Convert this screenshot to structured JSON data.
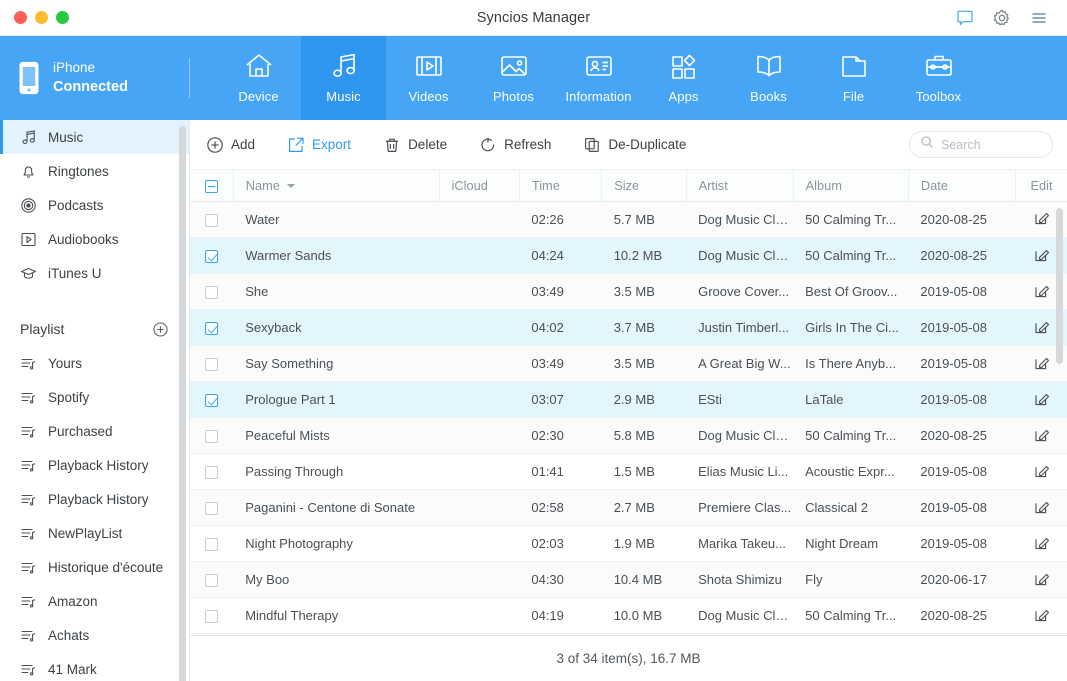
{
  "window": {
    "title": "Syncios Manager",
    "traffic_lights": [
      "close",
      "minimize",
      "maximize"
    ],
    "actions": [
      {
        "name": "feedback-icon",
        "label": "Feedback",
        "color": "#53aef0"
      },
      {
        "name": "gear-icon",
        "label": "Settings",
        "color": "#7b8187"
      },
      {
        "name": "menu-icon",
        "label": "Menu",
        "color": "#6f8ea8"
      }
    ]
  },
  "topnav": {
    "background": "#46a5f5",
    "active_background": "#2f96ef",
    "device": {
      "icon": "iphone-icon",
      "name": "iPhone",
      "status": "Connected"
    },
    "tabs": [
      {
        "label": "Device",
        "icon": "home-icon",
        "active": false
      },
      {
        "label": "Music",
        "icon": "music-note-icon",
        "active": true
      },
      {
        "label": "Videos",
        "icon": "film-play-icon",
        "active": false
      },
      {
        "label": "Photos",
        "icon": "photo-icon",
        "active": false
      },
      {
        "label": "Information",
        "icon": "contact-card-icon",
        "active": false
      },
      {
        "label": "Apps",
        "icon": "apps-grid-icon",
        "active": false
      },
      {
        "label": "Books",
        "icon": "book-icon",
        "active": false
      },
      {
        "label": "File",
        "icon": "folder-icon",
        "active": false
      },
      {
        "label": "Toolbox",
        "icon": "toolbox-icon",
        "active": false
      }
    ]
  },
  "sidebar": {
    "active_background": "#e3f3fd",
    "accent": "#2f9bf0",
    "library": [
      {
        "label": "Music",
        "icon": "music-note-icon",
        "active": true
      },
      {
        "label": "Ringtones",
        "icon": "bell-icon",
        "active": false
      },
      {
        "label": "Podcasts",
        "icon": "podcast-icon",
        "active": false
      },
      {
        "label": "Audiobooks",
        "icon": "audiobook-icon",
        "active": false
      },
      {
        "label": "iTunes U",
        "icon": "graduation-cap-icon",
        "active": false
      }
    ],
    "playlist_header": {
      "label": "Playlist",
      "add_icon": "plus-circle-icon"
    },
    "playlists": [
      {
        "label": "Yours",
        "icon": "playlist-icon"
      },
      {
        "label": "Spotify",
        "icon": "playlist-icon"
      },
      {
        "label": "Purchased",
        "icon": "playlist-icon"
      },
      {
        "label": "Playback History",
        "icon": "playlist-icon"
      },
      {
        "label": "Playback History",
        "icon": "playlist-icon"
      },
      {
        "label": "NewPlayList",
        "icon": "playlist-icon"
      },
      {
        "label": "Historique d'écoute",
        "icon": "playlist-icon"
      },
      {
        "label": "Amazon",
        "icon": "playlist-icon"
      },
      {
        "label": "Achats",
        "icon": "playlist-icon"
      },
      {
        "label": "41 Mark",
        "icon": "playlist-icon"
      }
    ]
  },
  "toolbar": {
    "buttons": [
      {
        "label": "Add",
        "icon": "plus-circle-icon",
        "accent": false
      },
      {
        "label": "Export",
        "icon": "export-icon",
        "accent": true
      },
      {
        "label": "Delete",
        "icon": "trash-icon",
        "accent": false
      },
      {
        "label": "Refresh",
        "icon": "refresh-icon",
        "accent": false
      },
      {
        "label": "De-Duplicate",
        "icon": "copy-icon",
        "accent": false
      }
    ],
    "search": {
      "placeholder": "Search",
      "value": "",
      "icon": "search-icon"
    }
  },
  "table": {
    "select_all_state": "indeterminate",
    "sort_column": "Name",
    "columns": [
      {
        "key": "check",
        "label": ""
      },
      {
        "key": "name",
        "label": "Name"
      },
      {
        "key": "icloud",
        "label": "iCloud"
      },
      {
        "key": "time",
        "label": "Time"
      },
      {
        "key": "size",
        "label": "Size"
      },
      {
        "key": "artist",
        "label": "Artist"
      },
      {
        "key": "album",
        "label": "Album"
      },
      {
        "key": "date",
        "label": "Date"
      },
      {
        "key": "edit",
        "label": "Edit"
      }
    ],
    "rows": [
      {
        "checked": false,
        "name": "Water",
        "icloud": "",
        "time": "02:26",
        "size": "5.7 MB",
        "artist": "Dog Music Clu...",
        "album": "50 Calming Tr...",
        "date": "2020-08-25"
      },
      {
        "checked": true,
        "name": "Warmer Sands",
        "icloud": "",
        "time": "04:24",
        "size": "10.2 MB",
        "artist": "Dog Music Clu...",
        "album": "50 Calming Tr...",
        "date": "2020-08-25"
      },
      {
        "checked": false,
        "name": "She",
        "icloud": "",
        "time": "03:49",
        "size": "3.5 MB",
        "artist": "Groove Cover...",
        "album": "Best Of Groov...",
        "date": "2019-05-08"
      },
      {
        "checked": true,
        "name": "Sexyback",
        "icloud": "",
        "time": "04:02",
        "size": "3.7 MB",
        "artist": "Justin Timberl...",
        "album": "Girls In The Ci...",
        "date": "2019-05-08"
      },
      {
        "checked": false,
        "name": "Say Something",
        "icloud": "",
        "time": "03:49",
        "size": "3.5 MB",
        "artist": "A Great Big W...",
        "album": "Is There Anyb...",
        "date": "2019-05-08"
      },
      {
        "checked": true,
        "name": "Prologue Part 1",
        "icloud": "",
        "time": "03:07",
        "size": "2.9 MB",
        "artist": "ESti",
        "album": "LaTale",
        "date": "2019-05-08"
      },
      {
        "checked": false,
        "name": "Peaceful Mists",
        "icloud": "",
        "time": "02:30",
        "size": "5.8 MB",
        "artist": "Dog Music Clu...",
        "album": "50 Calming Tr...",
        "date": "2020-08-25"
      },
      {
        "checked": false,
        "name": "Passing Through",
        "icloud": "",
        "time": "01:41",
        "size": "1.5 MB",
        "artist": "Elias Music Li...",
        "album": "Acoustic Expr...",
        "date": "2019-05-08"
      },
      {
        "checked": false,
        "name": "Paganini - Centone di Sonate",
        "icloud": "",
        "time": "02:58",
        "size": "2.7 MB",
        "artist": "Premiere Clas...",
        "album": "Classical 2",
        "date": "2019-05-08"
      },
      {
        "checked": false,
        "name": "Night Photography",
        "icloud": "",
        "time": "02:03",
        "size": "1.9 MB",
        "artist": "Marika Takeu...",
        "album": "Night Dream",
        "date": "2019-05-08"
      },
      {
        "checked": false,
        "name": "My Boo",
        "icloud": "",
        "time": "04:30",
        "size": "10.4 MB",
        "artist": "Shota Shimizu",
        "album": "Fly",
        "date": "2020-06-17"
      },
      {
        "checked": false,
        "name": "Mindful Therapy",
        "icloud": "",
        "time": "04:19",
        "size": "10.0 MB",
        "artist": "Dog Music Clu...",
        "album": "50 Calming Tr...",
        "date": "2020-08-25"
      }
    ],
    "edit_icon": "edit-pencil-icon"
  },
  "statusbar": {
    "text": "3 of 34 item(s), 16.7 MB"
  }
}
